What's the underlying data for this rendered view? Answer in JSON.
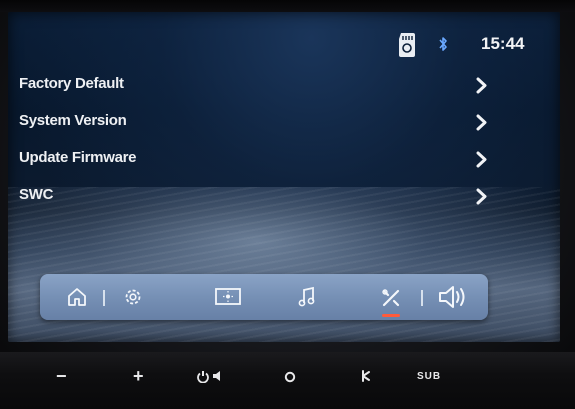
{
  "status_bar": {
    "time": "15:44",
    "icons": [
      "sd-card-icon",
      "bluetooth-icon"
    ]
  },
  "menu": {
    "items": [
      {
        "label": "Factory Default",
        "icon": "chevron-right-icon"
      },
      {
        "label": "System Version",
        "icon": "chevron-right-icon"
      },
      {
        "label": "Update Firmware",
        "icon": "chevron-right-icon"
      },
      {
        "label": "SWC",
        "icon": "chevron-right-icon"
      }
    ]
  },
  "dock": {
    "items": [
      "home-icon",
      "settings-icon",
      "display-icon",
      "music-icon",
      "tools-icon",
      "volume-icon"
    ],
    "active": "tools-icon",
    "active_color": "#ff5a3a"
  },
  "hardware_panel": {
    "buttons": [
      {
        "label": "−",
        "icon": "volume-down"
      },
      {
        "label": "+",
        "icon": "volume-up"
      },
      {
        "label": "",
        "icon": "power-mute-icon"
      },
      {
        "label": "",
        "icon": "circle-icon"
      },
      {
        "label": "",
        "icon": "mic-icon"
      },
      {
        "label": "SUB",
        "icon": "subwoofer"
      }
    ]
  }
}
